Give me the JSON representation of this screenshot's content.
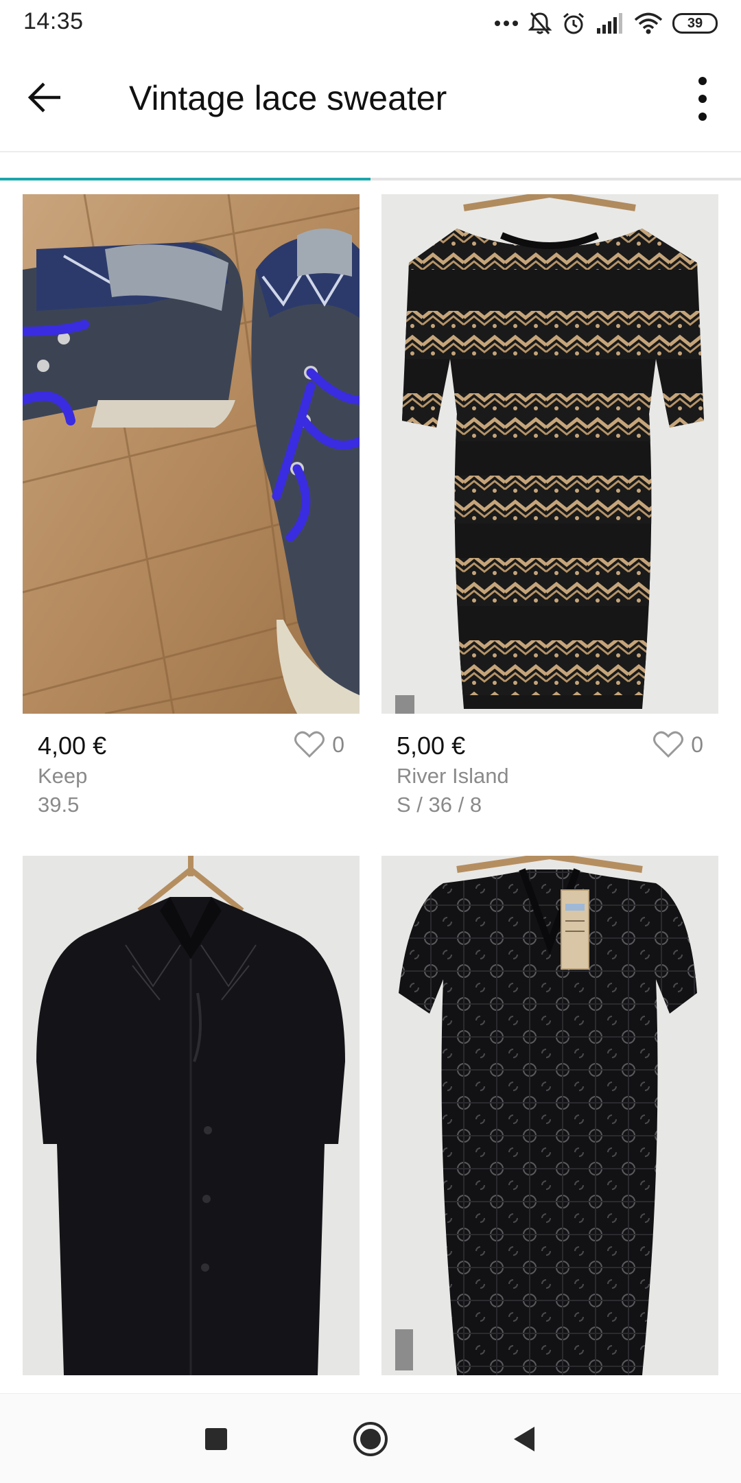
{
  "status_bar": {
    "time": "14:35",
    "battery": "39"
  },
  "app_bar": {
    "title": "Vintage lace sweater"
  },
  "progress": {
    "fraction": 0.5
  },
  "items": [
    {
      "price": "4,00 €",
      "brand": "Keep",
      "size": "39.5",
      "likes": "0",
      "image": "sneakers-photo"
    },
    {
      "price": "5,00 €",
      "brand": "River Island",
      "size": "S / 36 / 8",
      "likes": "0",
      "image": "lace-dress-photo"
    },
    {
      "price": "",
      "brand": "",
      "size": "",
      "likes": "",
      "image": "black-blouse-photo"
    },
    {
      "price": "",
      "brand": "",
      "size": "",
      "likes": "",
      "image": "crochet-dress-photo"
    }
  ],
  "icons": {
    "back": "arrow-left-icon",
    "more": "more-vertical-icon",
    "favorite": "heart-outline-icon",
    "nav": [
      "square-icon",
      "circle-icon",
      "triangle-back-icon"
    ]
  },
  "colors": {
    "accent": "#1aa7ab",
    "text": "#111111",
    "secondary_text": "#8a8a8a",
    "background": "#ffffff"
  }
}
